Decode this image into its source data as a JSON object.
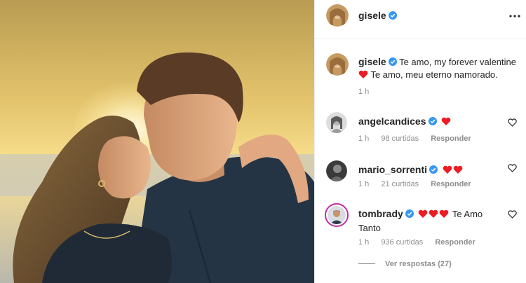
{
  "post": {
    "author": "gisele",
    "photo_alt": ""
  },
  "caption": {
    "author": "gisele",
    "text_line1": "Te amo, my forever valentine",
    "text_line2": "Te amo, meu eterno namorado.",
    "time": "1 h"
  },
  "comments": [
    {
      "user": "angelcandices",
      "text": "",
      "hearts": 1,
      "time": "1 h",
      "likes": "98 curtidas",
      "reply": "Responder",
      "verified": true
    },
    {
      "user": "mario_sorrenti",
      "text": "",
      "hearts": 2,
      "time": "1 h",
      "likes": "21 curtidas",
      "reply": "Responder",
      "verified": true
    },
    {
      "user": "tombrady",
      "text": "Te Amo Tanto",
      "hearts": 3,
      "time": "1 h",
      "likes": "936 curtidas",
      "reply": "Responder",
      "verified": true
    }
  ],
  "view_replies": "Ver respostas (27)",
  "icons": {
    "verified": "verified-badge-icon",
    "heart": "red-heart-emoji",
    "like": "heart-outline-icon",
    "more": "more-options-icon"
  },
  "colors": {
    "verified": "#3897f0",
    "heart": "#ed1c24",
    "muted": "#8e8e8e",
    "text": "#262626",
    "story_ring": "#c32aa3"
  }
}
